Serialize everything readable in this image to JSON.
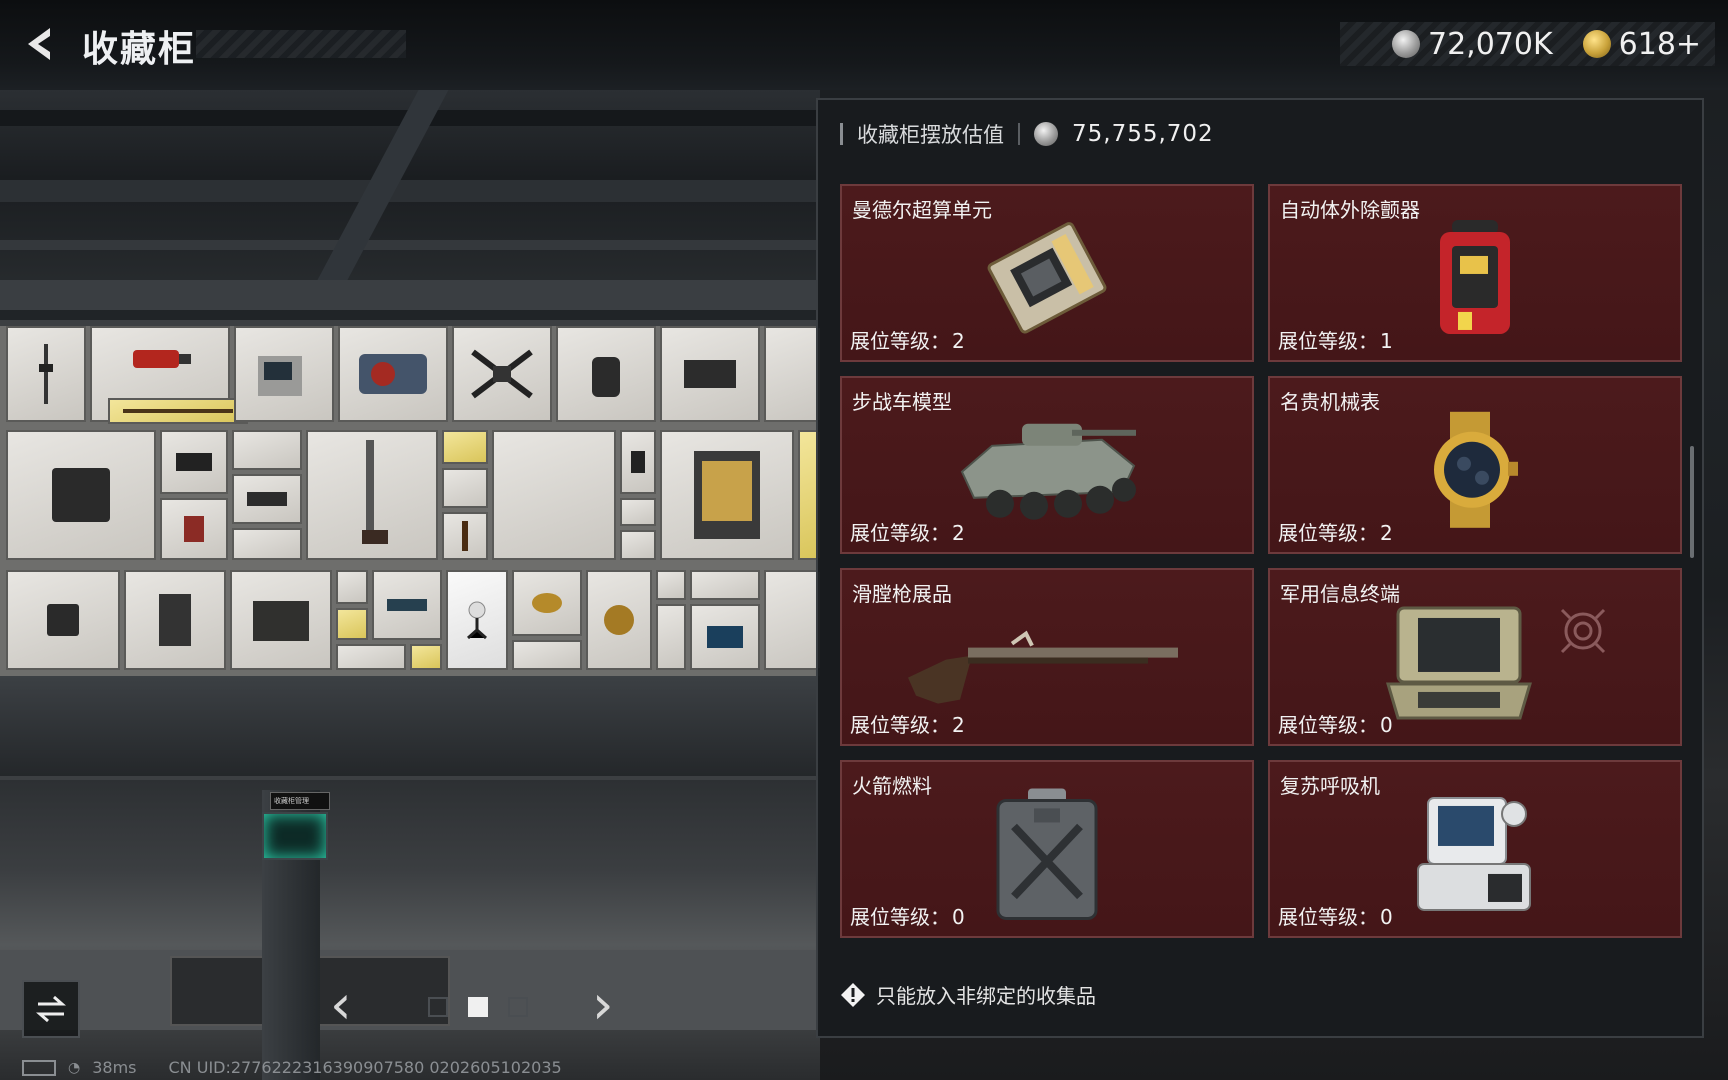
{
  "header": {
    "title": "收藏柜",
    "currency_primary": "72,070K",
    "currency_secondary": "618+"
  },
  "panel": {
    "label": "收藏柜摆放估值",
    "value": "75,755,702",
    "level_prefix": "展位等级：",
    "items": [
      {
        "name": "曼德尔超算单元",
        "level": "2"
      },
      {
        "name": "自动体外除颤器",
        "level": "1"
      },
      {
        "name": "步战车模型",
        "level": "2"
      },
      {
        "name": "名贵机械表",
        "level": "2"
      },
      {
        "name": "滑膛枪展品",
        "level": "2"
      },
      {
        "name": "军用信息终端",
        "level": "0"
      },
      {
        "name": "火箭燃料",
        "level": "0"
      },
      {
        "name": "复苏呼吸机",
        "level": "0"
      }
    ],
    "note": "只能放入非绑定的收集品"
  },
  "scene": {
    "kiosk_label": "收藏柜管理"
  },
  "status": {
    "ping": "38ms",
    "uid": "CN UID:2776222316390907580 0202605102035"
  },
  "pager": {
    "total": 3,
    "current": 2
  },
  "colors": {
    "card_bg": "#4c1a1c",
    "card_border": "#6d3a3c",
    "accent": "#f0f0f0"
  }
}
